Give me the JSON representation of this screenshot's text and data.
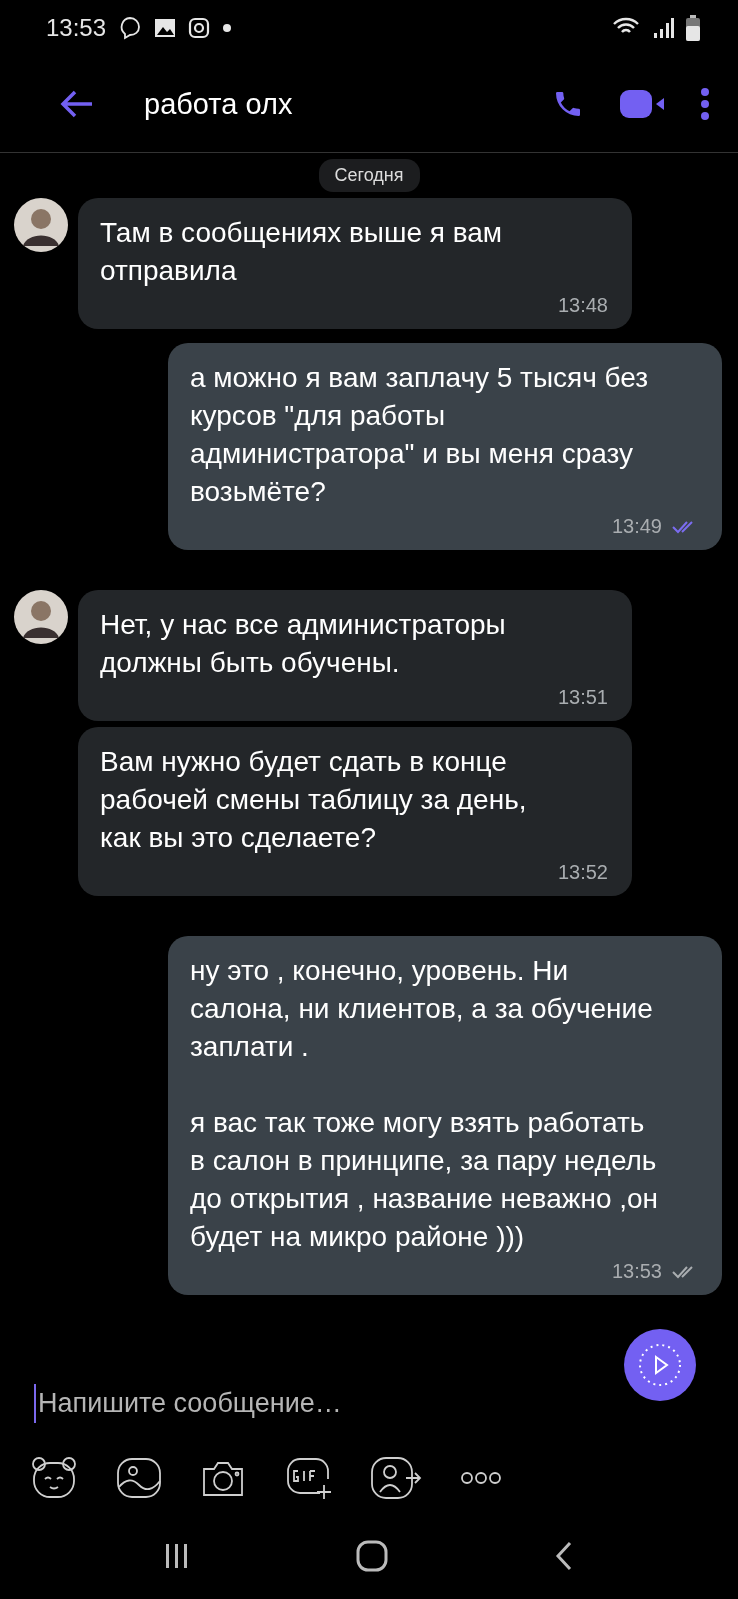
{
  "status_bar": {
    "time": "13:53"
  },
  "header": {
    "title": "работа олх"
  },
  "date_chip": "Сегодня",
  "messages": [
    {
      "kind": "incoming",
      "show_avatar": true,
      "text": "Там в сообщениях выше я вам отправила",
      "time": "13:48"
    },
    {
      "kind": "outgoing",
      "text": "а можно я вам заплачу 5 тысяч без курсов \"для работы администратора\" и вы меня сразу возьмёте?",
      "time": "13:49",
      "read": true
    },
    {
      "kind": "incoming",
      "show_avatar": true,
      "text": "Нет, у нас все администраторы должны быть обучены.",
      "time": "13:51"
    },
    {
      "kind": "incoming",
      "show_avatar": false,
      "text": "Вам нужно будет сдать в конце рабочей смены таблицу за день, как вы это сделаете?",
      "time": "13:52"
    },
    {
      "kind": "outgoing",
      "text": "ну это , конечно, уровень. Ни салона, ни клиентов, а за обучение заплати .\n\nя вас так тоже могу взять работать в салон в принципе, за пару недель до открытия , название неважно ,он будет на микро районе )))",
      "time": "13:53",
      "read": false
    }
  ],
  "composer": {
    "placeholder": "Напишите сообщение…"
  }
}
